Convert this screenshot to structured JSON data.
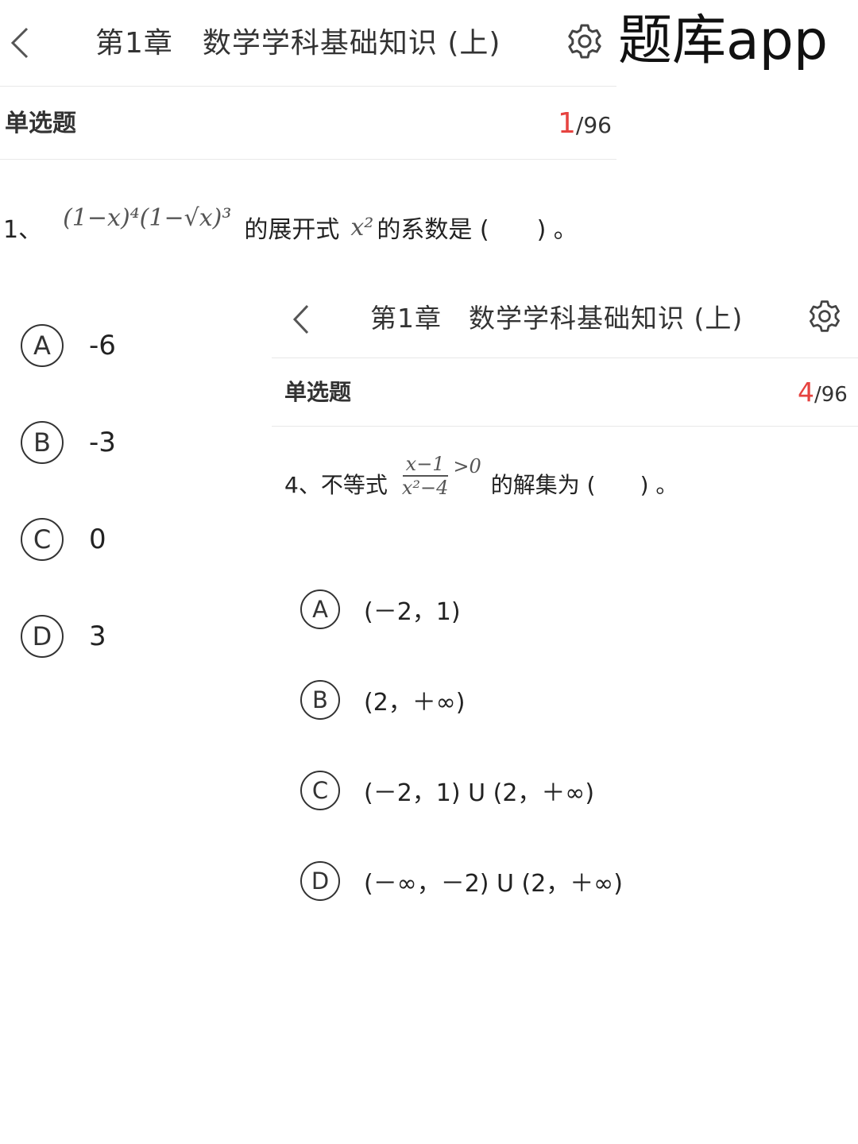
{
  "brand": "题库app",
  "panel1": {
    "title": "第1章　数学学科基础知识 (上)",
    "qtype": "单选题",
    "counter_current": "1",
    "counter_total": "/96",
    "question_number": "1、",
    "formula": "(1−x)⁴(1−√x)³",
    "text_a": "的展开式",
    "formula2": "x²",
    "text_b": "的系数是 (　　) 。",
    "options": [
      {
        "letter": "A",
        "value": "-6"
      },
      {
        "letter": "B",
        "value": "-3"
      },
      {
        "letter": "C",
        "value": "0"
      },
      {
        "letter": "D",
        "value": "3"
      }
    ]
  },
  "panel2": {
    "title": "第1章　数学学科基础知识 (上)",
    "qtype": "单选题",
    "counter_current": "4",
    "counter_total": "/96",
    "question_number": "4、",
    "text_a": "不等式",
    "frac_num": "x−1",
    "frac_den": "x²−4",
    "frac_rel": ">0",
    "text_b": "的解集为 (　　) 。",
    "options": [
      {
        "letter": "A",
        "value": "(－2，1)"
      },
      {
        "letter": "B",
        "value": "(2，＋∞)"
      },
      {
        "letter": "C",
        "value": "(－2，1) U (2，＋∞)"
      },
      {
        "letter": "D",
        "value": "(－∞，－2) U (2，＋∞)"
      }
    ]
  },
  "icons": {
    "back": "chevron-left-icon",
    "settings": "gear-icon"
  }
}
